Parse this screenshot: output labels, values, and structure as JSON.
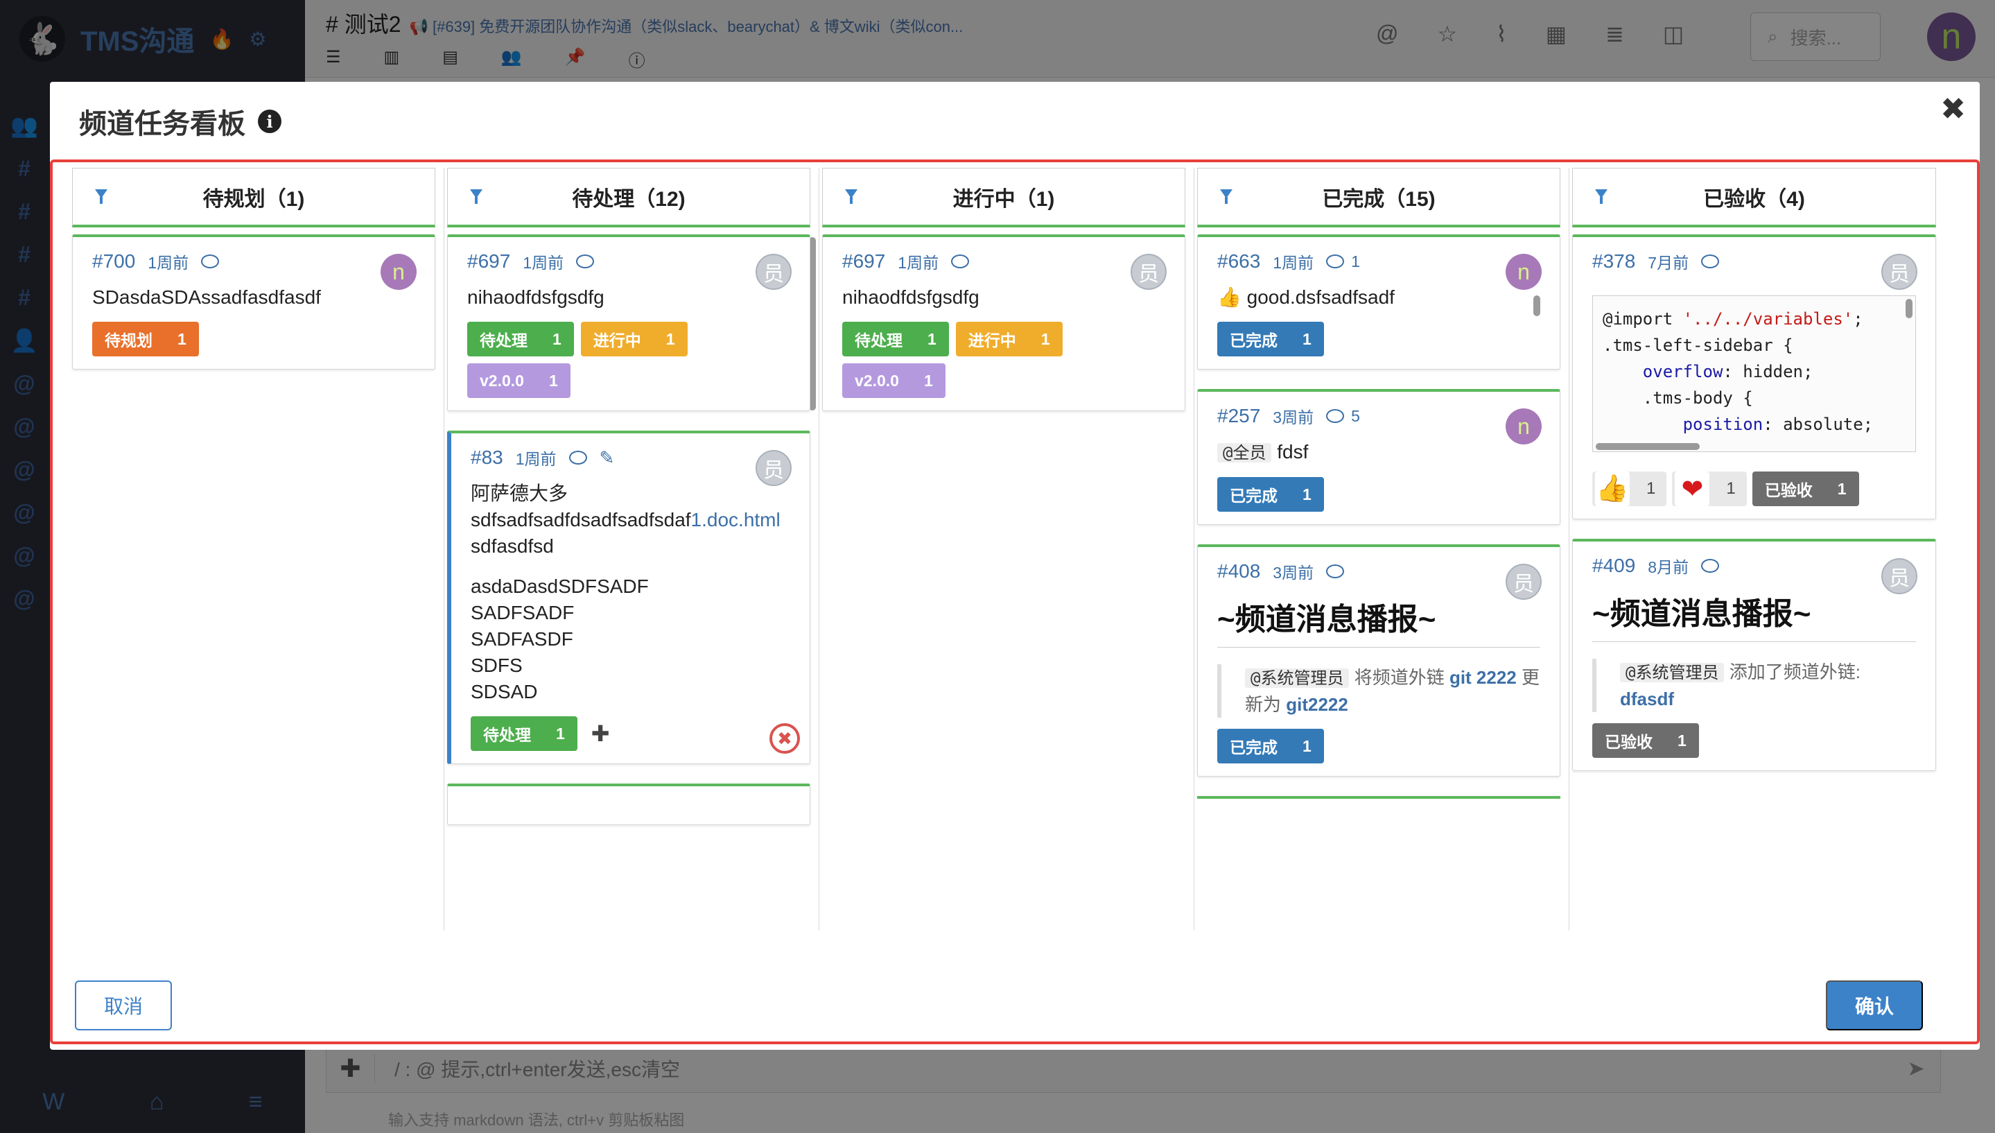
{
  "app": {
    "brand": "TMS沟通"
  },
  "topbar": {
    "channel_title": "# 测试2",
    "channel_desc": "📢 [#639] 免费开源团队协作沟通（类似slack、bearychat）& 博文wiki（类似con...",
    "search_placeholder": "搜索..."
  },
  "input": {
    "placeholder": "/ : @ 提示,ctrl+enter发送,esc清空",
    "hint": "输入支持 markdown 语法, ctrl+v 剪贴板粘图"
  },
  "modal": {
    "title": "频道任务看板",
    "cancel_label": "取消",
    "confirm_label": "确认",
    "close_glyph": "✖"
  },
  "columns": [
    {
      "title": "待规划（1)",
      "cards": [
        {
          "id": "#700",
          "time": "1周前",
          "comments": "",
          "avatar": "n",
          "text": "SDasdaSDAssadfasdfasdf",
          "tags": [
            {
              "label": "待规划",
              "count": "1",
              "color": "orange"
            }
          ]
        }
      ]
    },
    {
      "title": "待处理（12)",
      "cards": [
        {
          "id": "#697",
          "time": "1周前",
          "comments": "",
          "avatar": "员",
          "text": "nihaodfdsfgsdfg",
          "tags": [
            {
              "label": "待处理",
              "count": "1",
              "color": "green"
            },
            {
              "label": "进行中",
              "count": "1",
              "color": "yellow"
            },
            {
              "label": "v2.0.0",
              "count": "1",
              "color": "purple"
            }
          ]
        },
        {
          "id": "#83",
          "time": "1周前",
          "comments": "",
          "avatar": "员",
          "text_line1": "阿萨德大多",
          "text_line2": "sdfsadfsadfdsadfsadfsdaf",
          "text_link": "1.doc.html",
          "text_line3": "sdfasdfsd",
          "para2": [
            "asdaDasdSDFSADF",
            "SADFSADF",
            "SADFASDF",
            "SDFS",
            "SDSAD"
          ],
          "tags": [
            {
              "label": "待处理",
              "count": "1",
              "color": "green"
            }
          ],
          "plus": "✚",
          "delete": "✖"
        }
      ]
    },
    {
      "title": "进行中（1)",
      "cards": [
        {
          "id": "#697",
          "time": "1周前",
          "comments": "",
          "avatar": "员",
          "text": "nihaodfdsfgsdfg",
          "tags": [
            {
              "label": "待处理",
              "count": "1",
              "color": "green"
            },
            {
              "label": "进行中",
              "count": "1",
              "color": "yellow"
            },
            {
              "label": "v2.0.0",
              "count": "1",
              "color": "purple"
            }
          ]
        }
      ]
    },
    {
      "title": "已完成（15)",
      "cards": [
        {
          "id": "#663",
          "time": "1周前",
          "comments": "1",
          "avatar": "n",
          "emoji": "👍",
          "text": "good.dsfsadfsadf",
          "tags": [
            {
              "label": "已完成",
              "count": "1",
              "color": "blue"
            }
          ]
        },
        {
          "id": "#257",
          "time": "3周前",
          "comments": "5",
          "avatar": "n",
          "mention": "@全员",
          "text": "fdsf",
          "tags": [
            {
              "label": "已完成",
              "count": "1",
              "color": "blue"
            }
          ]
        },
        {
          "id": "#408",
          "time": "3周前",
          "comments": "",
          "avatar": "员",
          "heading": "~频道消息播报~",
          "quote_mention": "@系统管理员",
          "quote_text1": "将频道外链",
          "quote_link1": "git 2222",
          "quote_text2": "更新为",
          "quote_link2": "git2222",
          "tags": [
            {
              "label": "已完成",
              "count": "1",
              "color": "blue"
            }
          ]
        }
      ]
    },
    {
      "title": "已验收（4)",
      "cards": [
        {
          "id": "#378",
          "time": "7月前",
          "comments": "",
          "avatar": "员",
          "code": {
            "l1_kw": "@import",
            "l1_str": "'../../variables'",
            "l1_end": ";",
            "l2": ".tms-left-sidebar {",
            "l3_prop": "overflow",
            "l3_val": ": hidden;",
            "l4": ".tms-body {",
            "l5_prop": "position",
            "l5_val": ": absolute;"
          },
          "reactions": [
            {
              "emoji": "👍",
              "count": "1"
            },
            {
              "emoji": "❤",
              "count": "1"
            }
          ],
          "tags": [
            {
              "label": "已验收",
              "count": "1",
              "color": "grey"
            }
          ]
        },
        {
          "id": "#409",
          "time": "8月前",
          "comments": "",
          "avatar": "员",
          "heading": "~频道消息播报~",
          "quote_mention": "@系统管理员",
          "quote_text1": "添加了频道外链:",
          "quote_link1": "dfasdf",
          "tags": [
            {
              "label": "已验收",
              "count": "1",
              "color": "grey"
            }
          ]
        }
      ]
    }
  ]
}
